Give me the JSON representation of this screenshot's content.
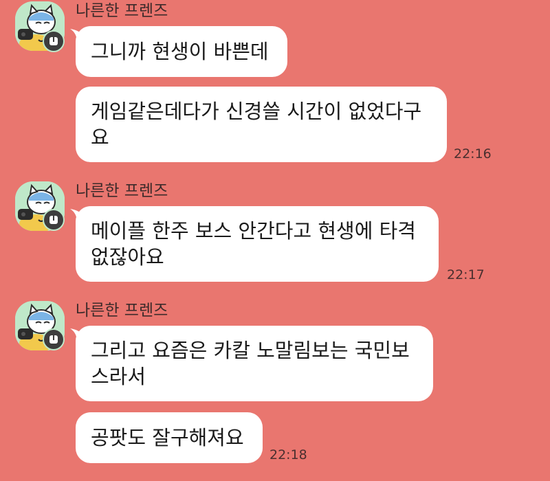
{
  "colors": {
    "background": "#e9766f",
    "bubble": "#ffffff",
    "avatar_bg": "#bfe8c9",
    "badge": "#3d3d3d"
  },
  "message_groups": [
    {
      "sender": "나른한 프렌즈",
      "avatar_icon": "cartoon-cat-avatar-icon",
      "badge_icon": "open-chat-badge-icon",
      "messages": [
        {
          "text": "그니까 현생이 바쁜데"
        },
        {
          "text": "게임같은데다가 신경쓸 시간이 없었다구\n요"
        }
      ],
      "time": "22:16"
    },
    {
      "sender": "나른한 프렌즈",
      "avatar_icon": "cartoon-cat-avatar-icon",
      "badge_icon": "open-chat-badge-icon",
      "messages": [
        {
          "text": "메이플 한주 보스 안간다고 현생에 타격\n없잖아요"
        }
      ],
      "time": "22:17"
    },
    {
      "sender": "나른한 프렌즈",
      "avatar_icon": "cartoon-cat-avatar-icon",
      "badge_icon": "open-chat-badge-icon",
      "messages": [
        {
          "text": "그리고 요즘은 카칼 노말림보는 국민보\n스라서"
        },
        {
          "text": "공팟도 잘구해져요"
        }
      ],
      "time": "22:18"
    }
  ]
}
